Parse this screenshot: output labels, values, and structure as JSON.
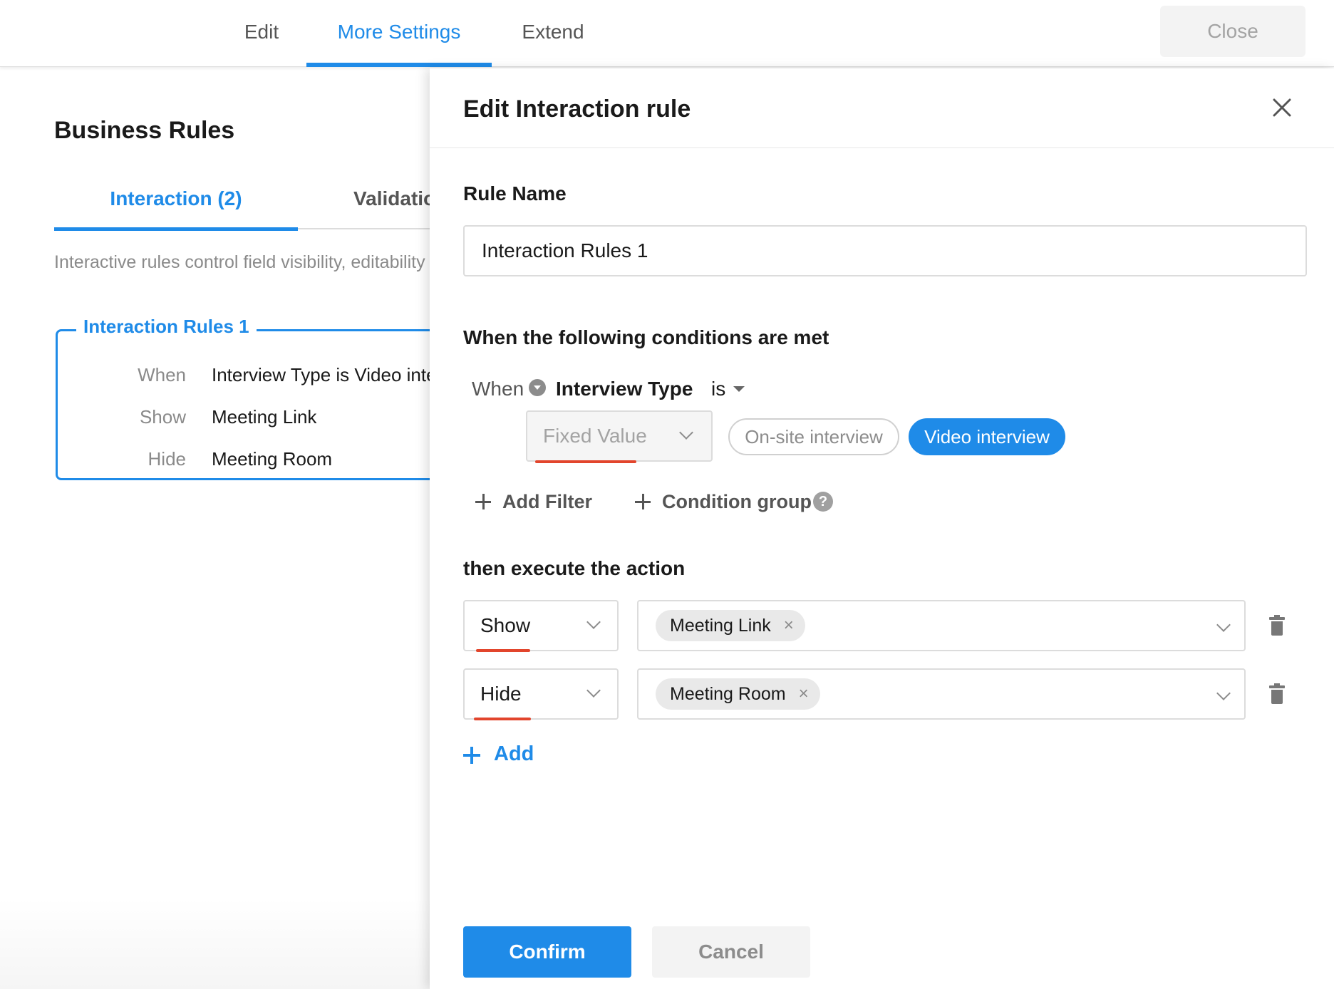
{
  "topnav": {
    "tabs": [
      {
        "label": "Edit"
      },
      {
        "label": "More Settings"
      },
      {
        "label": "Extend"
      }
    ],
    "close_label": "Close"
  },
  "business_rules": {
    "title": "Business Rules",
    "tabs": [
      {
        "label": "Interaction (2)"
      },
      {
        "label": "Validation"
      }
    ],
    "description": "Interactive rules control field visibility, editability",
    "rule_card": {
      "title": "Interaction Rules 1",
      "rows": [
        {
          "label": "When",
          "value": "Interview Type  is  Video interview"
        },
        {
          "label": "Show",
          "value": "Meeting Link"
        },
        {
          "label": "Hide",
          "value": "Meeting Room"
        }
      ]
    }
  },
  "drawer": {
    "title": "Edit Interaction rule",
    "rule_name_label": "Rule Name",
    "rule_name_value": "Interaction Rules 1",
    "conditions_label": "When the following conditions are met",
    "condition": {
      "when_label": "When",
      "field": "Interview Type",
      "operator": "is",
      "value_type": "Fixed Value",
      "options": [
        {
          "label": "On-site interview",
          "selected": false
        },
        {
          "label": "Video interview",
          "selected": true
        }
      ]
    },
    "add_filter_label": "Add Filter",
    "condition_group_label": "Condition group",
    "help_glyph": "?",
    "actions_label": "then execute the action",
    "actions": [
      {
        "type": "Show",
        "field": "Meeting Link"
      },
      {
        "type": "Hide",
        "field": "Meeting Room"
      }
    ],
    "tag_remove_glyph": "×",
    "add_label": "Add",
    "confirm_label": "Confirm",
    "cancel_label": "Cancel"
  },
  "colors": {
    "accent": "#1f8be8",
    "underline_red": "#e2452c"
  }
}
